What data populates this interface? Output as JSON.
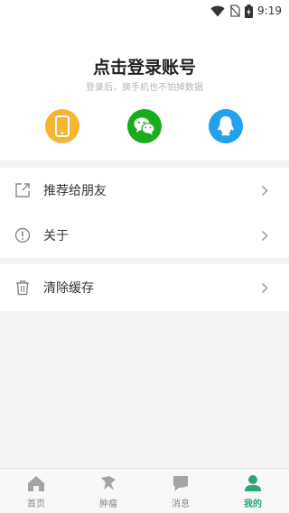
{
  "status_bar": {
    "time": "9:19",
    "icons": [
      "wifi-icon",
      "no-sim-icon",
      "battery-charging-icon"
    ]
  },
  "login": {
    "title": "点击登录账号",
    "subtitle": "登录后，换手机也不怕掉数据",
    "options": [
      {
        "icon": "phone-icon",
        "color": "#f7b532"
      },
      {
        "icon": "wechat-icon",
        "color": "#1aad19"
      },
      {
        "icon": "qq-icon",
        "color": "#22a2ee"
      }
    ]
  },
  "menu": {
    "recommend": {
      "label": "推荐给朋友",
      "icon": "share-icon"
    },
    "about": {
      "label": "关于",
      "icon": "info-icon"
    },
    "clear_cache": {
      "label": "清除缓存",
      "icon": "trash-icon"
    }
  },
  "tabbar": {
    "tabs": [
      {
        "label": "首页",
        "icon": "home-icon",
        "active": false
      },
      {
        "label": "肿瘤",
        "icon": "ribbon-icon",
        "active": false
      },
      {
        "label": "消息",
        "icon": "message-icon",
        "active": false
      },
      {
        "label": "我的",
        "icon": "profile-icon",
        "active": true
      }
    ],
    "active_color": "#2aa874",
    "inactive_color": "#8a8a8a"
  }
}
